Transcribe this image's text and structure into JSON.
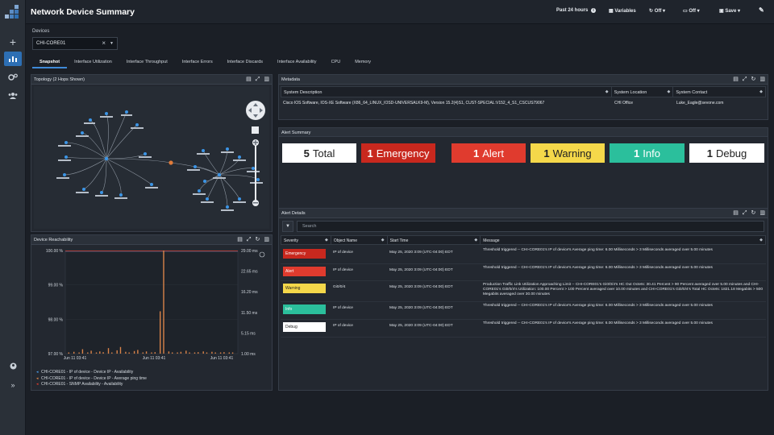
{
  "app": {
    "title": "Network Device Summary",
    "header": {
      "time_range": "Past 24 hours",
      "variables": "Variables",
      "refresh": "Off",
      "autorefresh": "Off",
      "save": "Save"
    }
  },
  "colors": {
    "accent": "#2d6fb4",
    "emergency": "#c8281e",
    "alert": "#e03b2e",
    "warning": "#f5d84a",
    "info": "#2bbf9c",
    "debug": "#ffffff",
    "link": "#4a9be8",
    "chart_line": "#d9834a"
  },
  "devices": {
    "label": "Devices",
    "selected": "CHI-CORE01"
  },
  "tabs": [
    "Snapshot",
    "Interface Utilization",
    "Interface Throughput",
    "Interface Errors",
    "Interface Discards",
    "Interface Availability",
    "CPU",
    "Memory"
  ],
  "topology": {
    "title": "Topology (2 Hops Shown)"
  },
  "metadata": {
    "title": "Metadata",
    "columns": [
      "System Description",
      "System Location",
      "System Contact"
    ],
    "row": [
      "Cisco IOS Software, IOS-XE Software (X86_64_LINUX_IOSD-UNIVERSALK9-M), Version 15.2(4)S1, CUST-SPECIAL:V152_4_S1_CSCUS79067",
      "CHI Office",
      "Luke_Eagle@sevone.com"
    ]
  },
  "alert_summary": {
    "title": "Alert Summary",
    "boxes": [
      {
        "count": "5",
        "label": "Total",
        "color": "#ffffff",
        "text": "#222222"
      },
      {
        "count": "1",
        "label": "Emergency",
        "color": "#c8281e",
        "text": "#ffffff"
      },
      {
        "count": "1",
        "label": "Alert",
        "color": "#e03b2e",
        "text": "#ffffff"
      },
      {
        "count": "1",
        "label": "Warning",
        "color": "#f5d84a",
        "text": "#222222"
      },
      {
        "count": "1",
        "label": "Info",
        "color": "#2bbf9c",
        "text": "#ffffff"
      },
      {
        "count": "1",
        "label": "Debug",
        "color": "#ffffff",
        "text": "#222222"
      }
    ]
  },
  "alert_details": {
    "title": "Alert Details",
    "search_placeholder": "Search",
    "columns": [
      "Severity",
      "Object Name",
      "Start Time",
      "Message"
    ],
    "rows": [
      {
        "severity": "Emergency",
        "sev_color": "#c8281e",
        "sev_text": "#ffffff",
        "object": "IP of device",
        "time": "May 25, 2020 3:09 (UTC-04:00) EDT",
        "message": "Threshold triggered -- CHI-CORE01's IP of device's Average ping time: 6.00 Milliseconds > 3 Milliseconds averaged over 5.00 minutes"
      },
      {
        "severity": "Alert",
        "sev_color": "#e03b2e",
        "sev_text": "#ffffff",
        "object": "IP of device",
        "time": "May 25, 2020 3:09 (UTC-04:00) EDT",
        "message": "Threshold triggered -- CHI-CORE01's IP of device's Average ping time: 6.00 Milliseconds > 3 Milliseconds averaged over 5.00 minutes"
      },
      {
        "severity": "Warning",
        "sev_color": "#f5d84a",
        "sev_text": "#222222",
        "object": "Gi0/0/4",
        "time": "May 25, 2020 3:09 (UTC-04:00) EDT",
        "message": "Production Traffic Link Utilization Approaching Limit -- CHI-CORE01's Gi0/0/4's HC Out Octets: 30.41 Percent > 90 Percent averaged over 5.00 minutes and CHI-CORE01's Gi0/0/4's Utilization: 100.00 Percent > 100 Percent averaged over 10.00 minutes and CHI-CORE01's Gi0/0/4's Total HC Octets: 1821.18 Megabits > 500 Megabits averaged over 30.00 minutes"
      },
      {
        "severity": "Info",
        "sev_color": "#2bbf9c",
        "sev_text": "#ffffff",
        "object": "IP of device",
        "time": "May 25, 2020 3:09 (UTC-04:00) EDT",
        "message": "Threshold triggered -- CHI-CORE01's IP of device's Average ping time: 6.00 Milliseconds > 3 Milliseconds averaged over 5.00 minutes"
      },
      {
        "severity": "Debug",
        "sev_color": "#ffffff",
        "sev_text": "#222222",
        "object": "IP of device",
        "time": "May 25, 2020 3:09 (UTC-04:00) EDT",
        "message": "Threshold triggered -- CHI-CORE01's IP of device's Average ping time: 6.00 Milliseconds > 3 Milliseconds averaged over 5.00 minutes"
      }
    ]
  },
  "reachability": {
    "title": "Device Reachability",
    "legend": [
      {
        "marker": "#4a9be8",
        "text": "CHI-CORE01 - IP of device - Device IP - Availability"
      },
      {
        "marker": "#d9834a",
        "text": "CHI-CORE01 - IP of device - Device IP - Average ping time"
      },
      {
        "marker": "#e03b2e",
        "text": "CHI-CORE01 - SNMP Availability - Availability"
      }
    ]
  },
  "chart_data": {
    "type": "line",
    "title": "Device Reachability",
    "y_left_ticks": [
      "100.00 %",
      "99.00 %",
      "98.00 %",
      "97.00 %"
    ],
    "y_left_range": [
      97,
      100
    ],
    "y_right_ticks": [
      "29.00 ms",
      "22.65 ms",
      "16.20 ms",
      "11.50 ms",
      "5.15 ms",
      "1.00 ms"
    ],
    "y_right_range": [
      1,
      29
    ],
    "x_ticks": [
      "Jun 11 03:41",
      "Jun 11 03:41",
      "Jun 11 03:41"
    ],
    "series": [
      {
        "name": "CHI-CORE01 - IP of device - Device IP - Availability",
        "color": "#4a9be8",
        "values": [
          100,
          100,
          100,
          100,
          100,
          100,
          100,
          100,
          100,
          100
        ]
      },
      {
        "name": "CHI-CORE01 - IP of device - Device IP - Average ping time",
        "color": "#d9834a",
        "x": [
          0.02,
          0.05,
          0.08,
          0.1,
          0.13,
          0.15,
          0.18,
          0.2,
          0.22,
          0.25,
          0.27,
          0.3,
          0.32,
          0.35,
          0.37,
          0.4,
          0.42,
          0.45,
          0.47,
          0.5,
          0.52,
          0.55,
          0.57,
          0.6,
          0.62,
          0.65,
          0.67,
          0.7,
          0.72,
          0.75,
          0.77,
          0.8,
          0.82,
          0.85,
          0.87,
          0.9,
          0.92,
          0.95,
          0.97
        ],
        "values": [
          1.2,
          1.5,
          1.1,
          2.2,
          1.3,
          1.8,
          1.2,
          1.6,
          1.4,
          2.5,
          1.3,
          1.9,
          2.8,
          1.5,
          1.2,
          1.7,
          2.0,
          1.3,
          1.6,
          1.2,
          1.4,
          12.5,
          29,
          1.6,
          1.3,
          1.2,
          1.5,
          1.8,
          1.3,
          1.2,
          1.4,
          1.6,
          1.3,
          1.5,
          1.2,
          1.3,
          1.4,
          1.2,
          1.3
        ]
      },
      {
        "name": "CHI-CORE01 - SNMP Availability - Availability",
        "color": "#e03b2e",
        "values": [
          100,
          100,
          100,
          100,
          100,
          100,
          100,
          100,
          100,
          100
        ]
      }
    ]
  }
}
